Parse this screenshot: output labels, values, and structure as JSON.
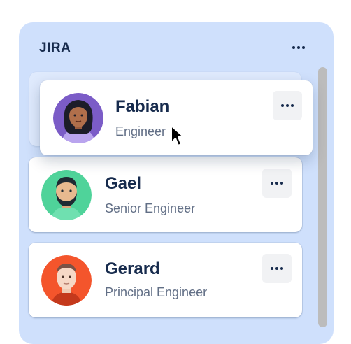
{
  "panel": {
    "title": "JIRA",
    "menu_icon": "more-horizontal-icon",
    "background": "#cfe0fc"
  },
  "cards": [
    {
      "name": "Fabian",
      "role": "Engineer",
      "avatar": "female-avatar-icon",
      "state": "dragging"
    },
    {
      "name": "Gael",
      "role": "Senior Engineer",
      "avatar": "bearded-man-avatar-icon"
    },
    {
      "name": "Gerard",
      "role": "Principal Engineer",
      "avatar": "man-avatar-icon"
    }
  ],
  "colors": {
    "text": "#172b4d",
    "subtext": "#626f86",
    "menu_bg": "#f1f2f4"
  }
}
